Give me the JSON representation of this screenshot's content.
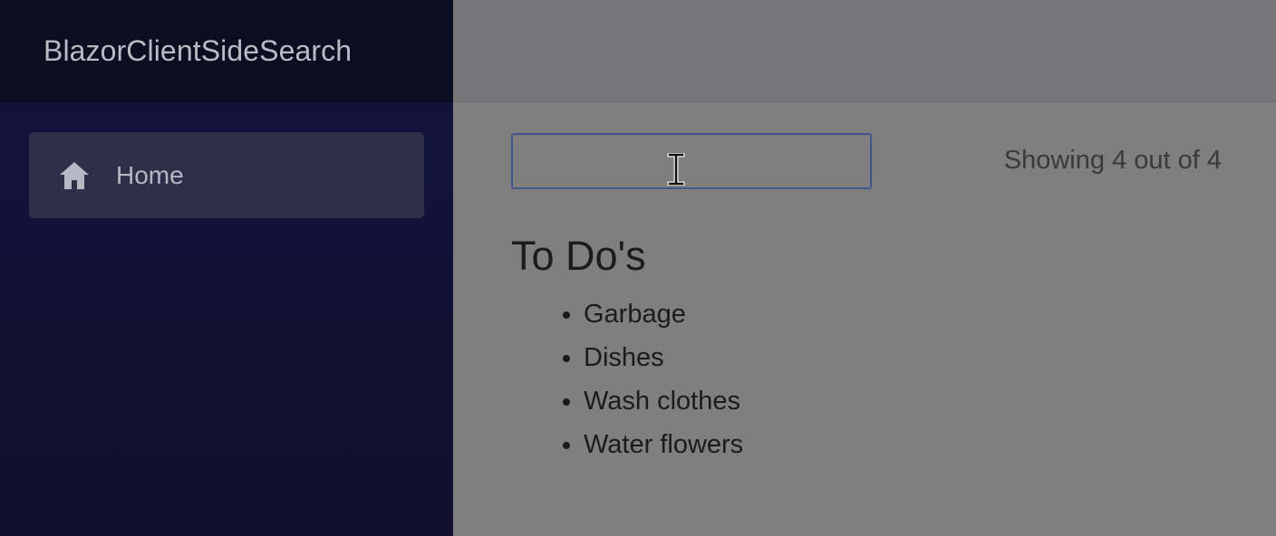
{
  "sidebar": {
    "brand": "BlazorClientSideSearch",
    "nav_items": [
      {
        "label": "Home",
        "icon": "home-icon"
      }
    ]
  },
  "search": {
    "value": "",
    "placeholder": ""
  },
  "status": {
    "count_text": "Showing 4 out of 4"
  },
  "todos": {
    "heading": "To Do's",
    "items": [
      "Garbage",
      "Dishes",
      "Wash clothes",
      "Water flowers"
    ]
  },
  "colors": {
    "sidebar_top": "#111440",
    "sidebar_bottom": "#12102e",
    "brand_bar": "#0b0e21",
    "input_border": "#41558e"
  }
}
